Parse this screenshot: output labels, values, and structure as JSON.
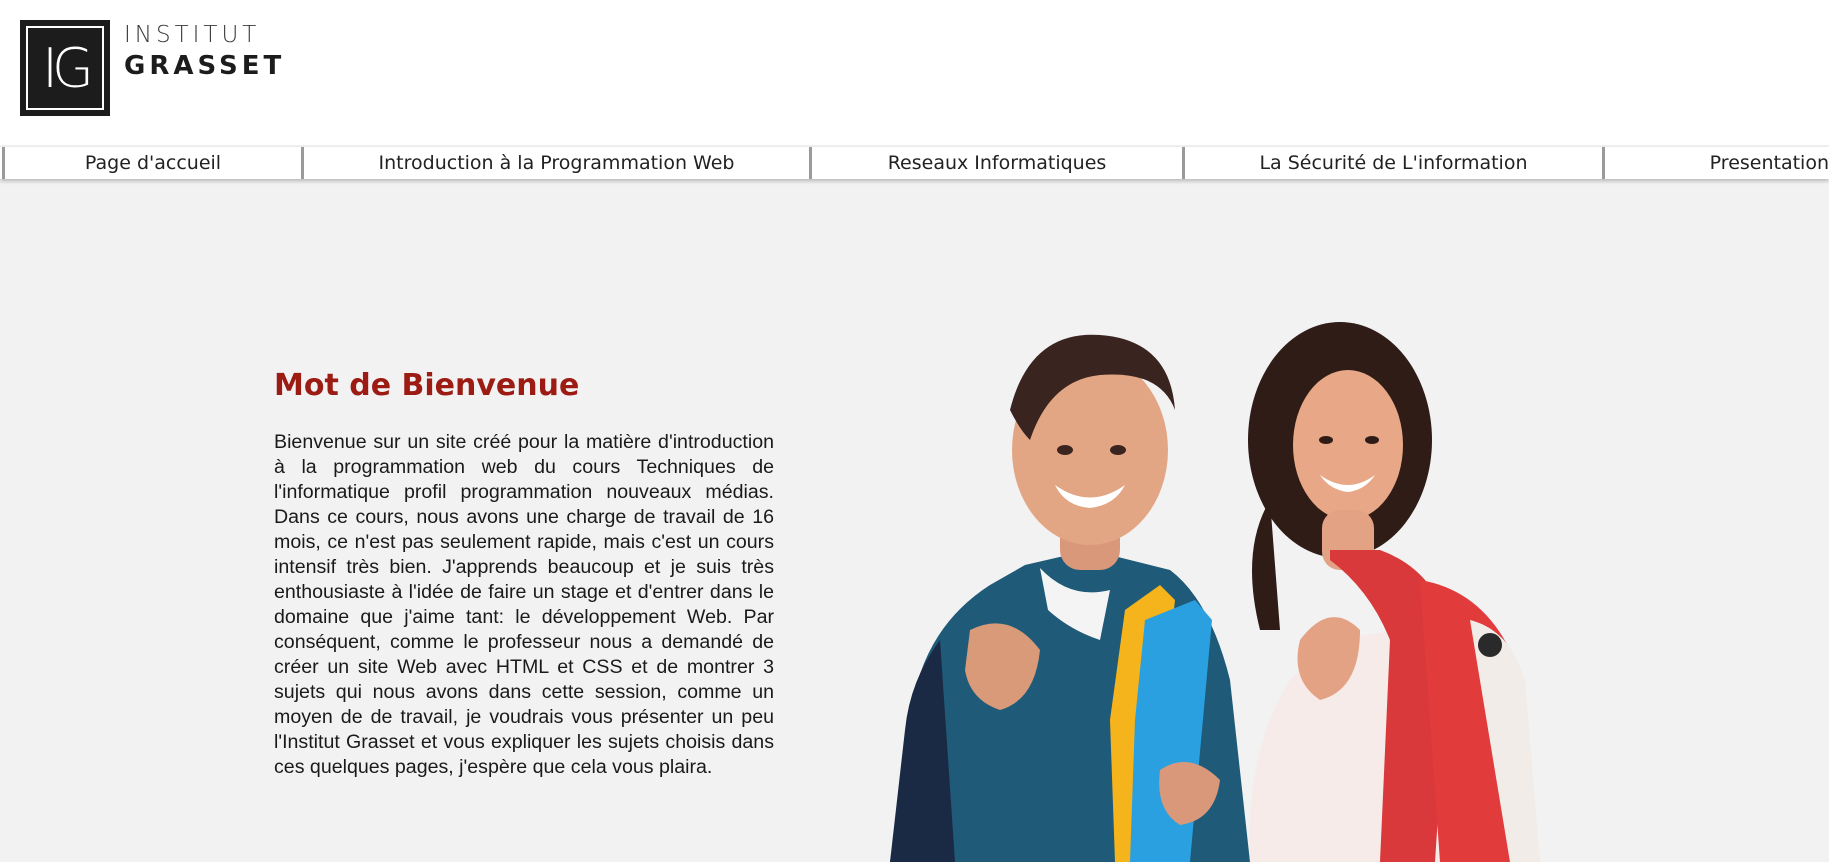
{
  "logo": {
    "line1": "INSTITUT",
    "line2": "GRASSET",
    "glyph": "IG"
  },
  "nav": {
    "items": [
      {
        "label": "Page d'accueil"
      },
      {
        "label": "Introduction à la Programmation Web"
      },
      {
        "label": "Reseaux Informatiques"
      },
      {
        "label": "La Sécurité de L'information"
      },
      {
        "label": "Presentation"
      }
    ]
  },
  "main": {
    "title": "Mot de Bienvenue",
    "body": "Bienvenue sur un site créé pour la matière d'introduction à la programmation web du cours Techniques de l'informatique profil programmation nouveaux médias. Dans ce cours, nous avons une charge de travail de 16 mois, ce n'est pas seulement rapide, mais c'est un cours intensif très bien. J'apprends beaucoup et je suis très enthousiaste à l'idée de faire un stage et d'entrer dans le domaine que j'aime tant: le développement Web. Par conséquent, comme le professeur nous a demandé de créer un site Web avec HTML et CSS et de montrer 3 sujets qui nous avons dans cette session, comme un moyen de de travail, je voudrais vous présenter un peu l'Institut Grasset et vous expliquer les sujets choisis dans ces quelques pages, j'espère que cela vous plaira."
  },
  "colors": {
    "title": "#9c1b12",
    "background": "#f2f2f3",
    "header": "#ffffff",
    "nav_divider": "#9a9a9a"
  }
}
